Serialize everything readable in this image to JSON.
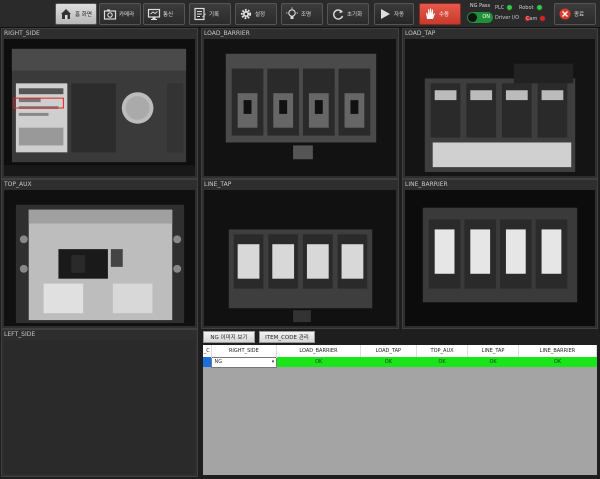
{
  "toolbar": {
    "buttons": [
      {
        "label": "홈 화면",
        "icon": "home-icon"
      },
      {
        "label": "카메라",
        "icon": "camera-icon"
      },
      {
        "label": "통신",
        "icon": "monitor-icon"
      },
      {
        "label": "기록",
        "icon": "log-icon"
      },
      {
        "label": "설정",
        "icon": "gear-icon"
      },
      {
        "label": "조명",
        "icon": "bulb-icon"
      },
      {
        "label": "초기화",
        "icon": "refresh-icon"
      }
    ],
    "auto_label": "자동",
    "manual_label": "수동",
    "ng_pass_label": "NG Pass",
    "ng_pass_state": "ON",
    "plc_label": "PLC",
    "robot_label": "Robot",
    "driver_label": "Driver I/O",
    "cam_label": "Cam",
    "exit_label": "종료",
    "colors": {
      "plc": "#2ecc40",
      "robot": "#2ecc40",
      "driver": "#e02020",
      "cam": "#e02020"
    }
  },
  "panels": [
    {
      "title": "RIGHT_SIDE"
    },
    {
      "title": "LOAD_BARRIER"
    },
    {
      "title": "LOAD_TAP"
    },
    {
      "title": "TOP_AUX"
    },
    {
      "title": "LINE_TAP"
    },
    {
      "title": "LINE_BARRIER"
    },
    {
      "title": "LEFT_SIDE"
    }
  ],
  "controls": {
    "ng_image_view": "NG 이미지 보기",
    "item_code": "ITEM_CODE 관리"
  },
  "table": {
    "headers": [
      "_C",
      "RIGHT_SIDE",
      "LOAD_BARRIER",
      "LOAD_TAP",
      "TOP_AUX",
      "LINE_TAP",
      "LINE_BARRIER"
    ],
    "row": {
      "select": "NG",
      "values": [
        "OK",
        "OK",
        "OK",
        "OK",
        "OK"
      ]
    }
  }
}
